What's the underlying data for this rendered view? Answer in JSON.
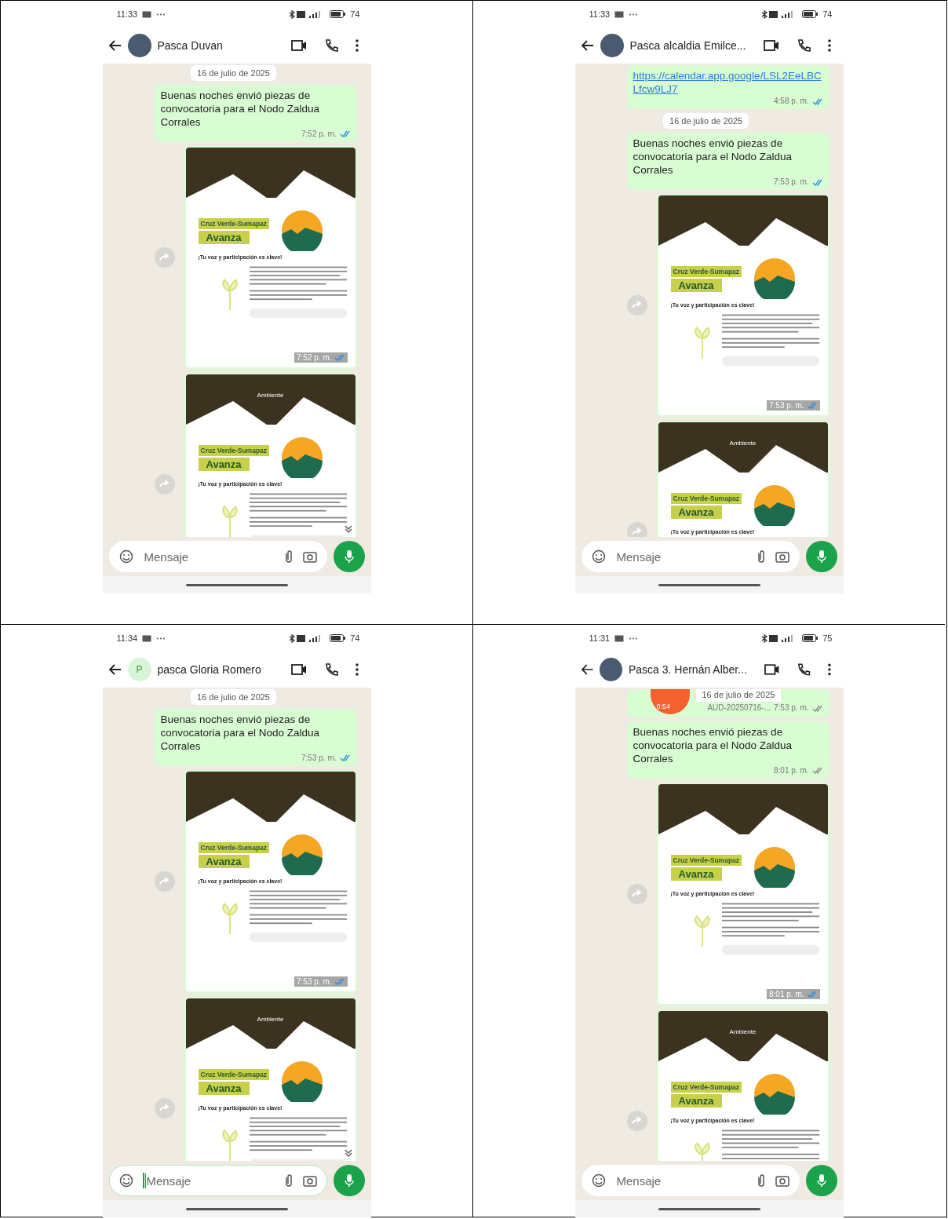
{
  "panels": [
    {
      "status": {
        "time": "11:33",
        "battery": "74"
      },
      "contact": {
        "name": "Pasca Duvan",
        "avatar": {
          "kind": "photo"
        }
      },
      "messages": [
        {
          "kind": "date",
          "text": "16 de julio de 2025"
        },
        {
          "kind": "text",
          "text": "Buenas noches envió piezas de convocatoria para el Nodo Zaldua Corrales",
          "time": "7:52 p. m.",
          "read": true
        },
        {
          "kind": "image",
          "title": "Cruz Verde-Sumapaz",
          "headline": "Avanza",
          "tagline": "¡Tu voz y participación es clave!",
          "time": "7:52 p. m.",
          "read": true
        },
        {
          "kind": "image",
          "overlay": "Ambiente",
          "title": "Cruz Verde-Sumapaz",
          "headline": "Avanza",
          "tagline": "¡Tu voz y participación es clave!"
        }
      ],
      "input": {
        "placeholder": "Mensaje",
        "focused": false
      }
    },
    {
      "status": {
        "time": "11:33",
        "battery": "74"
      },
      "contact": {
        "name": "Pasca alcaldia Emilce...",
        "avatar": {
          "kind": "photo"
        }
      },
      "messages": [
        {
          "kind": "link",
          "text": "https://calendar.app.google/LSL2EeLBCLfcw9LJ7",
          "time": "4:58 p. m.",
          "read": true
        },
        {
          "kind": "date",
          "text": "16 de julio de 2025"
        },
        {
          "kind": "text",
          "text": "Buenas noches envió piezas de convocatoria para el Nodo Zaldua Corrales",
          "time": "7:53 p. m.",
          "read": true
        },
        {
          "kind": "image",
          "title": "Cruz Verde-Sumapaz",
          "headline": "Avanza",
          "tagline": "¡Tu voz y participación es clave!",
          "time": "7:53 p. m.",
          "read": true
        },
        {
          "kind": "image",
          "overlay": "Ambiente",
          "title": "Cruz Verde-Sumapaz",
          "headline": "Avanza",
          "tagline": "¡Tu voz y participación es clave!"
        }
      ],
      "input": {
        "placeholder": "Mensaje",
        "focused": false
      }
    },
    {
      "status": {
        "time": "11:34",
        "battery": "74"
      },
      "contact": {
        "name": "pasca Gloria Romero",
        "avatar": {
          "kind": "letter",
          "initial": "P"
        }
      },
      "messages": [
        {
          "kind": "date",
          "text": "16 de julio de 2025"
        },
        {
          "kind": "text",
          "text": "Buenas noches envió piezas de convocatoria para el Nodo Zaldua Corrales",
          "time": "7:53 p. m.",
          "read": true
        },
        {
          "kind": "image",
          "title": "Cruz Verde-Sumapaz",
          "headline": "Avanza",
          "tagline": "¡Tu voz y participación es clave!",
          "time": "7:53 p. m.",
          "read": true
        },
        {
          "kind": "image",
          "overlay": "Ambiente",
          "title": "Cruz Verde-Sumapaz",
          "headline": "Avanza",
          "tagline": "¡Tu voz y participación es clave!"
        }
      ],
      "input": {
        "placeholder": "Mensaje",
        "focused": true
      }
    },
    {
      "status": {
        "time": "11:31",
        "battery": "75"
      },
      "contact": {
        "name": "Pasca 3. Hernán Alber...",
        "avatar": {
          "kind": "photo"
        }
      },
      "messages": [
        {
          "kind": "audio",
          "date": "16 de julio de 2025",
          "duration": "0:54",
          "file": "AUD-20250716-...",
          "time": "7:53 p. m.",
          "read": false
        },
        {
          "kind": "text",
          "text": "Buenas noches envió piezas de convocatoria para el Nodo Zaldua Corrales",
          "time": "8:01 p. m.",
          "read": false
        },
        {
          "kind": "image",
          "title": "Cruz Verde-Sumapaz",
          "headline": "Avanza",
          "tagline": "¡Tu voz y participación es clave!",
          "time": "8:01 p. m.",
          "read": true
        },
        {
          "kind": "image",
          "overlay": "Ambiente",
          "title": "Cruz Verde-Sumapaz",
          "headline": "Avanza",
          "tagline": "¡Tu voz y participación es clave!"
        }
      ],
      "input": {
        "placeholder": "Mensaje",
        "focused": false
      }
    }
  ]
}
